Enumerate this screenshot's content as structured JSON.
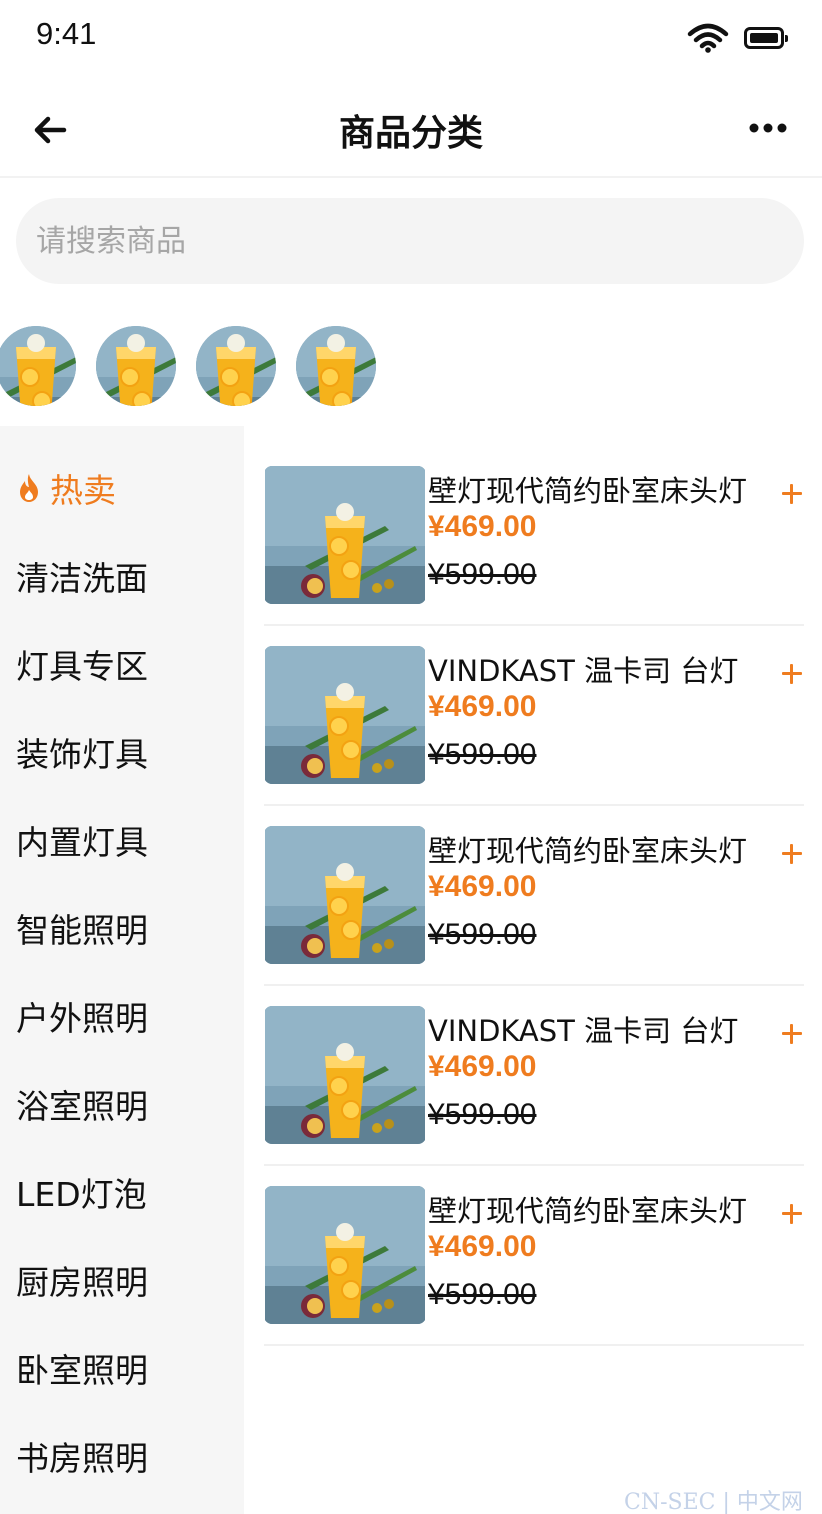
{
  "status_bar": {
    "time": "9:41"
  },
  "nav": {
    "title": "商品分类"
  },
  "search": {
    "placeholder": "请搜索商品"
  },
  "banners": [
    {
      "icon": "juice-drink-image"
    },
    {
      "icon": "juice-drink-image"
    },
    {
      "icon": "juice-drink-image"
    },
    {
      "icon": "juice-drink-image"
    }
  ],
  "sidebar": {
    "active_index": 0,
    "active_icon": "fire-icon",
    "items": [
      {
        "label": "热卖"
      },
      {
        "label": "清洁洗面"
      },
      {
        "label": "灯具专区"
      },
      {
        "label": "装饰灯具"
      },
      {
        "label": "内置灯具"
      },
      {
        "label": "智能照明"
      },
      {
        "label": "户外照明"
      },
      {
        "label": "浴室照明"
      },
      {
        "label": "LED灯泡"
      },
      {
        "label": "厨房照明"
      },
      {
        "label": "卧室照明"
      },
      {
        "label": "书房照明"
      }
    ]
  },
  "products": [
    {
      "name": "壁灯现代简约卧室床头灯",
      "price": "¥469.00",
      "original_price": "¥599.00"
    },
    {
      "name": "VINDKAST 温卡司 台灯",
      "price": "¥469.00",
      "original_price": "¥599.00"
    },
    {
      "name": "壁灯现代简约卧室床头灯",
      "price": "¥469.00",
      "original_price": "¥599.00"
    },
    {
      "name": "VINDKAST 温卡司 台灯",
      "price": "¥469.00",
      "original_price": "¥599.00"
    },
    {
      "name": "壁灯现代简约卧室床头灯",
      "price": "¥469.00",
      "original_price": "¥599.00"
    }
  ],
  "colors": {
    "accent": "#ef7c1f",
    "sidebar_bg": "#f6f6f6",
    "search_bg": "#f4f4f4"
  },
  "watermark": "CN-SEC | 中文网"
}
